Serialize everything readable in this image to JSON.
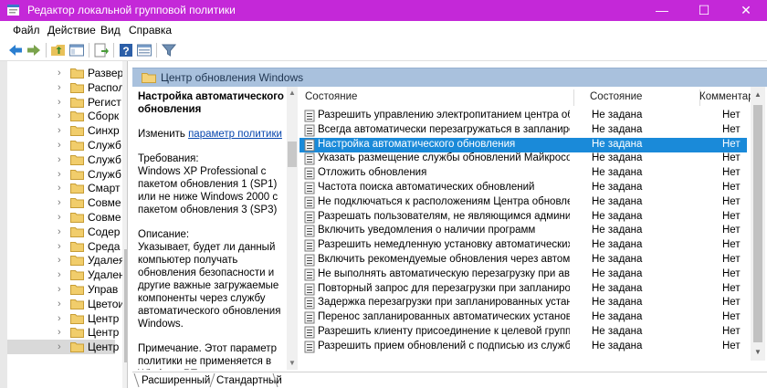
{
  "window": {
    "title": "Редактор локальной групповой политики",
    "minimize": "—",
    "maximize": "☐",
    "close": "✕"
  },
  "menu": [
    "Файл",
    "Действие",
    "Вид",
    "Справка"
  ],
  "toolbar_icons": [
    "back-arrow-icon",
    "forward-arrow-icon",
    "up-folder-icon",
    "show-hide-tree-icon",
    "export-list-icon",
    "help-icon",
    "extended-view-icon",
    "filter-icon"
  ],
  "tree": {
    "items": [
      "Развер",
      "Распол",
      "Регист",
      "Сборк",
      "Синхр",
      "Служб",
      "Служб",
      "Служб",
      "Смарт",
      "Совме",
      "Совме",
      "Содер",
      "Среда",
      "Удалея",
      "Удален",
      "Управ",
      "Цветои",
      "Центр",
      "Центр",
      "Центр"
    ],
    "selected_index": 19
  },
  "header": {
    "title": "Центр обновления Windows"
  },
  "description": {
    "title": "Настройка автоматического обновления",
    "edit_prefix": "Изменить ",
    "edit_link": "параметр политики",
    "requirements": "Требования:\nWindows XP Professional с пакетом обновления 1 (SP1) или не ниже Windows 2000 с пакетом обновления 3 (SP3)",
    "description": "Описание:\nУказывает, будет ли данный компьютер получать обновления безопасности и другие важные загружаемые компоненты через службу автоматического обновления Windows.",
    "note": "Примечание. Этот параметр политики не применяется в Windows RT."
  },
  "list": {
    "columns": [
      "Состояние",
      "Состояние",
      "Комментар"
    ],
    "selected_index": 2,
    "rows": [
      {
        "name": "Разрешить управлению электропитанием центра обнов...",
        "state": "Не задана",
        "comment": "Нет"
      },
      {
        "name": "Всегда автоматически перезагружаться в запланированн...",
        "state": "Не задана",
        "comment": "Нет"
      },
      {
        "name": "Настройка автоматического обновления",
        "state": "Не задана",
        "comment": "Нет"
      },
      {
        "name": "Указать размещение службы обновлений Майкрософт в ...",
        "state": "Не задана",
        "comment": "Нет"
      },
      {
        "name": "Отложить обновления",
        "state": "Не задана",
        "comment": "Нет"
      },
      {
        "name": "Частота поиска автоматических обновлений",
        "state": "Не задана",
        "comment": "Нет"
      },
      {
        "name": "Не подключаться к расположениям Центра обновления ...",
        "state": "Не задана",
        "comment": "Нет"
      },
      {
        "name": "Разрешать пользователям, не являющимся администрат...",
        "state": "Не задана",
        "comment": "Нет"
      },
      {
        "name": "Включить уведомления о наличии программ",
        "state": "Не задана",
        "comment": "Нет"
      },
      {
        "name": "Разрешить немедленную установку автоматических обн...",
        "state": "Не задана",
        "comment": "Нет"
      },
      {
        "name": "Включить рекомендуемые обновления через автоматиче...",
        "state": "Не задана",
        "comment": "Нет"
      },
      {
        "name": "Не выполнять автоматическую перезагрузку при автома...",
        "state": "Не задана",
        "comment": "Нет"
      },
      {
        "name": "Повторный запрос для перезагрузки при запланирован...",
        "state": "Не задана",
        "comment": "Нет"
      },
      {
        "name": "Задержка перезагрузки при запланированных установках",
        "state": "Не задана",
        "comment": "Нет"
      },
      {
        "name": "Перенос запланированных автоматических установок обн...",
        "state": "Не задана",
        "comment": "Нет"
      },
      {
        "name": "Разрешить клиенту присоединение к целевой группе",
        "state": "Не задана",
        "comment": "Нет"
      },
      {
        "name": "Разрешить прием обновлений с подписью из службы об...",
        "state": "Не задана",
        "comment": "Нет"
      }
    ]
  },
  "tabs": [
    "Расширенный",
    "Стандартный"
  ],
  "colors": {
    "titlebar": "#c428d8",
    "header_band": "#a9c1dd",
    "selection": "#1a8ad9",
    "link": "#0645ad"
  }
}
